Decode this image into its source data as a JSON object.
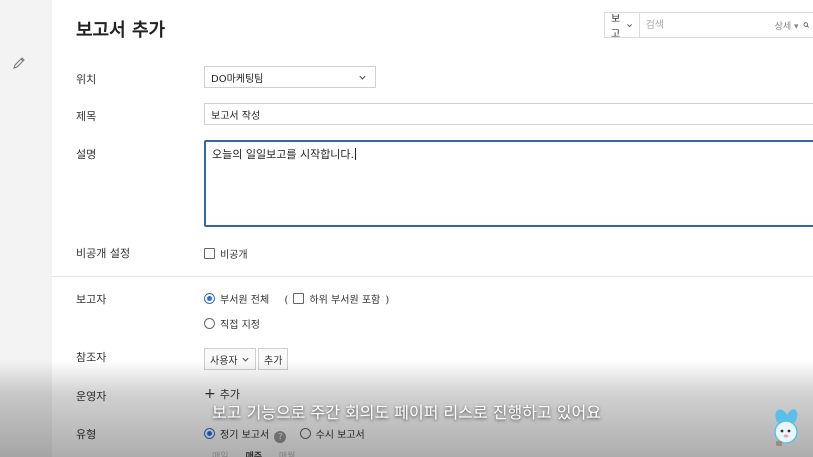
{
  "page": {
    "title": "보고서 추가"
  },
  "search": {
    "scope": "보고",
    "placeholder": "검색",
    "detail_label": "상세 ▾"
  },
  "form": {
    "location": {
      "label": "위치",
      "value": "DO마케팅팀"
    },
    "title": {
      "label": "제목",
      "value": "보고서 작성"
    },
    "description": {
      "label": "설명",
      "value": "오늘의 일일보고를 시작합니다."
    },
    "private": {
      "label": "비공개 설정",
      "checkbox_label": "비공개"
    },
    "reporter": {
      "label": "보고자",
      "option_all": "부서원 전체",
      "sub_open": "(",
      "sub_label": "하위 부서원 포함",
      "sub_close": ")",
      "option_direct": "직접 지정"
    },
    "reference": {
      "label": "참조자",
      "select_value": "사용자",
      "add_button": "추가"
    },
    "operator": {
      "label": "운영자",
      "add_label": "추가"
    },
    "type": {
      "label": "유형",
      "option_regular": "정기 보고서",
      "option_adhoc": "수시 보고서"
    }
  },
  "bottom_tabs": {
    "first": "매일",
    "second": "매주",
    "third": "매월"
  },
  "overlay": {
    "subtitle": "보고 기능으로 주간 회의도 페이퍼 리스로 진행하고 있어요"
  },
  "colors": {
    "accent": "#2f6fd8",
    "focus_border": "#3a64a8"
  }
}
